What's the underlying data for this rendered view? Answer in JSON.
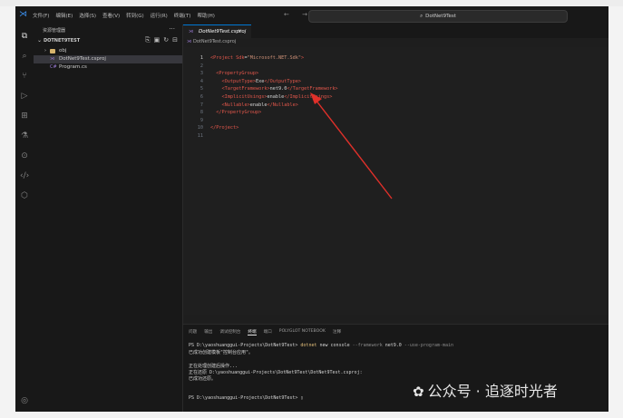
{
  "titlebar": {
    "menu": [
      "文件(F)",
      "编辑(E)",
      "选择(S)",
      "查看(V)",
      "转到(G)",
      "运行(R)",
      "终端(T)",
      "帮助(H)"
    ],
    "nav_arrows": "← →",
    "command_center": "DotNet9Test"
  },
  "sidebar": {
    "title": "资源管理器",
    "more": "···",
    "section": "DOTNET9TEST",
    "items": [
      {
        "label": "obj",
        "type": "folder"
      },
      {
        "label": "DotNet9Test.csproj",
        "type": "csproj"
      },
      {
        "label": "Program.cs",
        "type": "cs"
      }
    ]
  },
  "tab": {
    "label": "DotNet9Test.csproj",
    "close": "×"
  },
  "breadcrumb": "DotNet9Test.csproj",
  "editor": {
    "lines": [
      {
        "n": "1",
        "indent": "",
        "parts": [
          [
            "tg",
            "<Project "
          ],
          [
            "an",
            "Sdk"
          ],
          [
            "tx",
            "="
          ],
          [
            "at",
            "\"Microsoft.NET.Sdk\""
          ],
          [
            "tg",
            ">"
          ]
        ]
      },
      {
        "n": "2",
        "indent": "",
        "parts": []
      },
      {
        "n": "3",
        "indent": "  ",
        "parts": [
          [
            "tg",
            "<PropertyGroup>"
          ]
        ]
      },
      {
        "n": "4",
        "indent": "    ",
        "parts": [
          [
            "tg",
            "<OutputType>"
          ],
          [
            "tx",
            "Exe"
          ],
          [
            "tg",
            "</OutputType>"
          ]
        ]
      },
      {
        "n": "5",
        "indent": "    ",
        "parts": [
          [
            "tg",
            "<TargetFramework>"
          ],
          [
            "tx",
            "net9.0"
          ],
          [
            "tg",
            "</TargetFramework>"
          ]
        ]
      },
      {
        "n": "6",
        "indent": "    ",
        "parts": [
          [
            "tg",
            "<ImplicitUsings>"
          ],
          [
            "tx",
            "enable"
          ],
          [
            "tg",
            "</ImplicitUsings>"
          ]
        ]
      },
      {
        "n": "7",
        "indent": "    ",
        "parts": [
          [
            "tg",
            "<Nullable>"
          ],
          [
            "tx",
            "enable"
          ],
          [
            "tg",
            "</Nullable>"
          ]
        ]
      },
      {
        "n": "8",
        "indent": "  ",
        "parts": [
          [
            "tg",
            "</PropertyGroup>"
          ]
        ]
      },
      {
        "n": "9",
        "indent": "",
        "parts": []
      },
      {
        "n": "10",
        "indent": "",
        "parts": [
          [
            "tg",
            "</Project>"
          ]
        ]
      },
      {
        "n": "11",
        "indent": "",
        "parts": []
      }
    ]
  },
  "panel": {
    "tabs": [
      "问题",
      "输出",
      "调试控制台",
      "终端",
      "端口",
      "POLYGLOT NOTEBOOK",
      "注释"
    ],
    "active_tab": "终端",
    "terminal": [
      [
        [
          "tx",
          "PS D:\\yaoshuanggui-Projects\\DotNet9Test> "
        ],
        [
          "cmd",
          "dotnet"
        ],
        [
          "tx",
          " new console "
        ],
        [
          "dim",
          "--framework"
        ],
        [
          "tx",
          " net9.0 "
        ],
        [
          "dim",
          "--use-program-main"
        ]
      ],
      [
        [
          "tx",
          "已成功创建模板\"控制台应用\"。"
        ]
      ],
      [],
      [
        [
          "tx",
          "正在处理创建后操作..."
        ]
      ],
      [
        [
          "tx",
          "正在还原 D:\\yaoshuanggui-Projects\\DotNet9Test\\DotNet9Test.csproj:"
        ]
      ],
      [
        [
          "tx",
          "已成功还原。"
        ]
      ],
      [],
      [],
      [
        [
          "tx",
          "PS D:\\yaoshuanggui-Projects\\DotNet9Test> ▯"
        ]
      ]
    ]
  },
  "watermark": "公众号 · 追逐时光者"
}
